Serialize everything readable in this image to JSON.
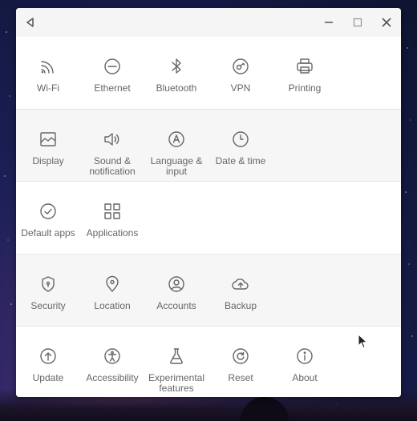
{
  "window": {
    "title_controls": {
      "back": "back-icon",
      "minimize": "minimize-icon",
      "maximize": "maximize-icon",
      "close": "close-icon"
    }
  },
  "sections": [
    {
      "items": [
        {
          "label": "Wi-Fi",
          "icon": "wifi-icon"
        },
        {
          "label": "Ethernet",
          "icon": "ethernet-icon"
        },
        {
          "label": "Bluetooth",
          "icon": "bluetooth-icon"
        },
        {
          "label": "VPN",
          "icon": "vpn-icon"
        },
        {
          "label": "Printing",
          "icon": "printer-icon"
        }
      ]
    },
    {
      "items": [
        {
          "label": "Display",
          "icon": "display-icon"
        },
        {
          "label": "Sound & notification",
          "icon": "volume-icon"
        },
        {
          "label": "Language & input",
          "icon": "language-icon"
        },
        {
          "label": "Date & time",
          "icon": "clock-icon"
        }
      ]
    },
    {
      "items": [
        {
          "label": "Default apps",
          "icon": "check-circle-icon"
        },
        {
          "label": "Applications",
          "icon": "apps-grid-icon"
        }
      ]
    },
    {
      "items": [
        {
          "label": "Security",
          "icon": "shield-icon"
        },
        {
          "label": "Location",
          "icon": "location-icon"
        },
        {
          "label": "Accounts",
          "icon": "account-icon"
        },
        {
          "label": "Backup",
          "icon": "cloud-upload-icon"
        }
      ]
    },
    {
      "items": [
        {
          "label": "Update",
          "icon": "update-icon"
        },
        {
          "label": "Accessibility",
          "icon": "accessibility-icon"
        },
        {
          "label": "Experimental features",
          "icon": "flask-icon"
        },
        {
          "label": "Reset",
          "icon": "reset-icon"
        },
        {
          "label": "About",
          "icon": "info-icon"
        }
      ]
    }
  ]
}
